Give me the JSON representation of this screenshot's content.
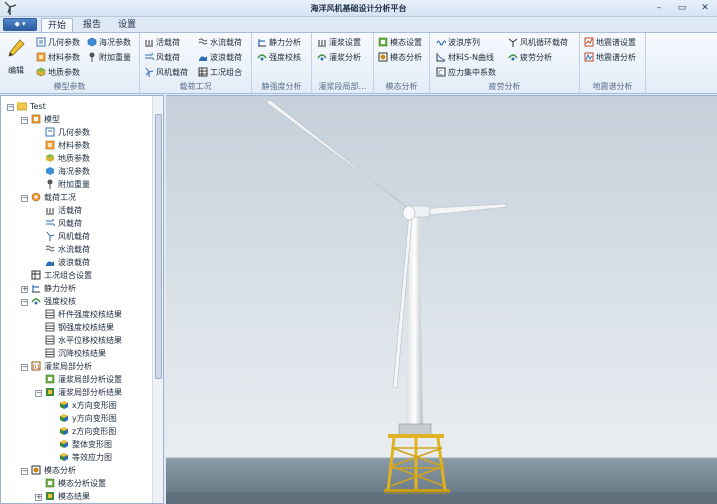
{
  "window": {
    "title": "海洋风机基础设计分析平台",
    "controls": [
      "–",
      "▭",
      "✕"
    ]
  },
  "tabs": [
    {
      "label": "开始",
      "active": true
    },
    {
      "label": "报告",
      "active": false
    },
    {
      "label": "设置",
      "active": false
    }
  ],
  "ribbon": {
    "edit": "编辑",
    "groups": {
      "model": {
        "label": "模型参数",
        "items": [
          "几何参数",
          "海况参数",
          "材料参数",
          "附加重量",
          "地质参数"
        ]
      },
      "load": {
        "label": "载荷工况",
        "items": [
          "活载荷",
          "水流载荷",
          "风载荷",
          "波浪载荷",
          "风机载荷",
          "工况组合"
        ]
      },
      "static": {
        "label": "静强度分析",
        "items": [
          "静力分析",
          "强度校核"
        ]
      },
      "grout": {
        "label": "灌浆段局部…",
        "items": [
          "灌浆设置",
          "灌浆分析"
        ]
      },
      "modal": {
        "label": "模态分析",
        "items": [
          "模态设置",
          "模态分析"
        ]
      },
      "fatigue": {
        "label": "疲劳分析",
        "items": [
          "波浪序列",
          "风机循环载荷",
          "材料S-N曲线",
          "疲劳分析",
          "应力集中系数"
        ]
      },
      "seismic": {
        "label": "地震谱分析",
        "items": [
          "地震谱设置",
          "地震谱分析"
        ]
      }
    }
  },
  "tree": [
    {
      "label": "Test",
      "level": 0,
      "exp": "−",
      "icon": "folder-icon"
    },
    {
      "label": "模型",
      "level": 1,
      "exp": "−",
      "icon": "model-icon"
    },
    {
      "label": "几何参数",
      "level": 2,
      "exp": "",
      "icon": "geometry-icon"
    },
    {
      "label": "材料参数",
      "level": 2,
      "exp": "",
      "icon": "material-icon"
    },
    {
      "label": "地质参数",
      "level": 2,
      "exp": "",
      "icon": "geology-icon"
    },
    {
      "label": "海况参数",
      "level": 2,
      "exp": "",
      "icon": "sea-icon"
    },
    {
      "label": "附加重量",
      "level": 2,
      "exp": "",
      "icon": "weight-icon"
    },
    {
      "label": "载荷工况",
      "level": 1,
      "exp": "−",
      "icon": "load-icon"
    },
    {
      "label": "活载荷",
      "level": 2,
      "exp": "",
      "icon": "live-load-icon"
    },
    {
      "label": "风载荷",
      "level": 2,
      "exp": "",
      "icon": "wind-load-icon"
    },
    {
      "label": "风机载荷",
      "level": 2,
      "exp": "",
      "icon": "turbine-load-icon"
    },
    {
      "label": "水流载荷",
      "level": 2,
      "exp": "",
      "icon": "current-load-icon"
    },
    {
      "label": "波浪载荷",
      "level": 2,
      "exp": "",
      "icon": "wave-load-icon"
    },
    {
      "label": "工况组合设置",
      "level": 1,
      "exp": "",
      "icon": "combination-icon"
    },
    {
      "label": "静力分析",
      "level": 1,
      "exp": "+",
      "icon": "static-icon"
    },
    {
      "label": "强度校核",
      "level": 1,
      "exp": "−",
      "icon": "strength-icon"
    },
    {
      "label": "杆件强度校核结果",
      "level": 2,
      "exp": "",
      "icon": "table-icon"
    },
    {
      "label": "钢强度校核结果",
      "level": 2,
      "exp": "",
      "icon": "table-icon"
    },
    {
      "label": "水平位移校核结果",
      "level": 2,
      "exp": "",
      "icon": "table-icon"
    },
    {
      "label": "沉降校核结果",
      "level": 2,
      "exp": "",
      "icon": "table-icon"
    },
    {
      "label": "灌浆局部分析",
      "level": 1,
      "exp": "−",
      "icon": "grout-icon"
    },
    {
      "label": "灌浆局部分析设置",
      "level": 2,
      "exp": "",
      "icon": "settings-icon"
    },
    {
      "label": "灌浆局部分析结果",
      "level": 2,
      "exp": "−",
      "icon": "result-icon"
    },
    {
      "label": "x方向变形图",
      "level": 3,
      "exp": "",
      "icon": "cube-icon"
    },
    {
      "label": "y方向变形图",
      "level": 3,
      "exp": "",
      "icon": "cube-icon"
    },
    {
      "label": "z方向变形图",
      "level": 3,
      "exp": "",
      "icon": "cube-icon"
    },
    {
      "label": "整体变形图",
      "level": 3,
      "exp": "",
      "icon": "cube-icon"
    },
    {
      "label": "等效应力图",
      "level": 3,
      "exp": "",
      "icon": "cube-icon"
    },
    {
      "label": "模态分析",
      "level": 1,
      "exp": "−",
      "icon": "modal-icon"
    },
    {
      "label": "模态分析设置",
      "level": 2,
      "exp": "",
      "icon": "settings-icon"
    },
    {
      "label": "模态结果",
      "level": 2,
      "exp": "+",
      "icon": "result-icon"
    }
  ],
  "colors": {
    "accent": "#2c5da0",
    "sky_top": "#c9d3dc",
    "sky_bottom": "#eef1f3",
    "sea": "#6f8290",
    "jacket": "#e0b321"
  }
}
